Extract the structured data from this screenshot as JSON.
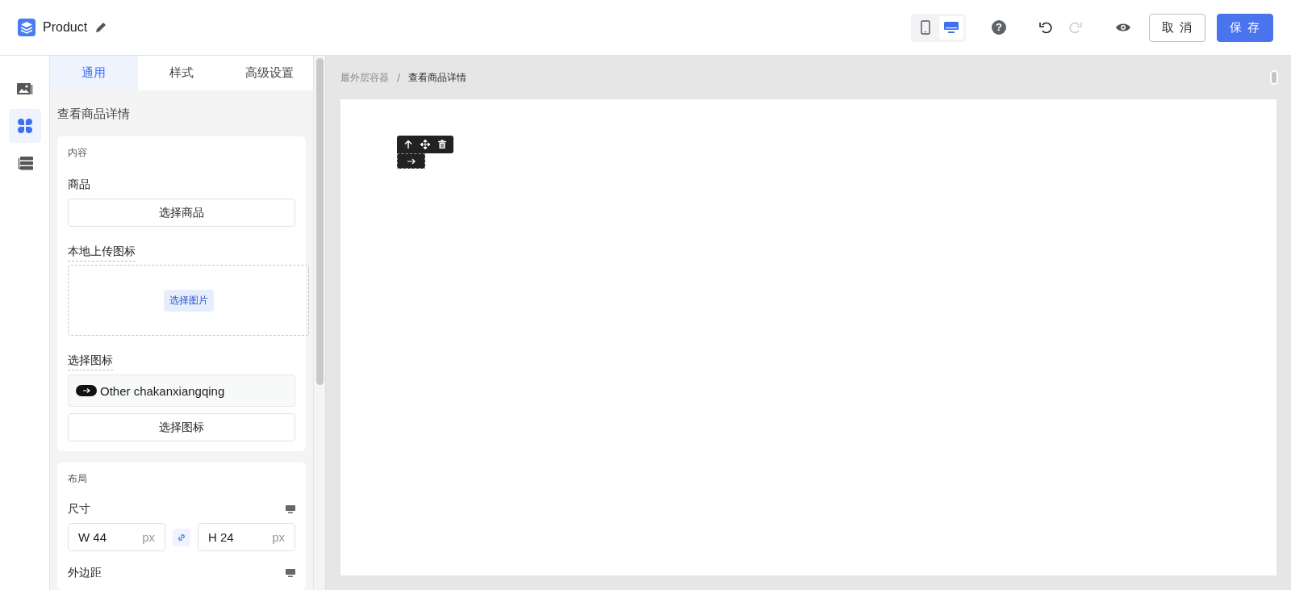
{
  "header": {
    "title": "Product",
    "devices": [
      {
        "kind": "mobile",
        "selected": false
      },
      {
        "kind": "desktop",
        "selected": true
      }
    ],
    "help_glyph": "?",
    "redo_disabled": true,
    "buttons": [
      {
        "kind": "secondary",
        "label": "取 消"
      },
      {
        "kind": "primary",
        "label": "保 存"
      }
    ]
  },
  "rail": [
    {
      "kind": "image",
      "selected": false
    },
    {
      "kind": "components",
      "selected": true
    },
    {
      "kind": "layers",
      "selected": false
    }
  ],
  "tabs": [
    {
      "label": "通用",
      "selected": true
    },
    {
      "label": "样式",
      "selected": false
    },
    {
      "label": "高级设置",
      "selected": false
    }
  ],
  "panel_title": "查看商品详情",
  "content_section": {
    "title": "内容",
    "product_label": "商品",
    "product_button": "选择商品",
    "upload_label": "本地上传图标",
    "upload_button": "选择图片",
    "icon_label": "选择图标",
    "icon_value": "Other chakanxiangqing",
    "icon_button": "选择图标"
  },
  "layout_section": {
    "title": "布局",
    "size_label": "尺寸",
    "width": "W 44",
    "height": "H 24",
    "unit_w": "px",
    "unit_h": "px",
    "link_locked": true,
    "margin_label": "外边距"
  },
  "breadcrumb": [
    {
      "label": "最外层容器",
      "current": false
    },
    {
      "label": "查看商品详情",
      "current": true
    }
  ],
  "breadcrumb_separator": "/"
}
